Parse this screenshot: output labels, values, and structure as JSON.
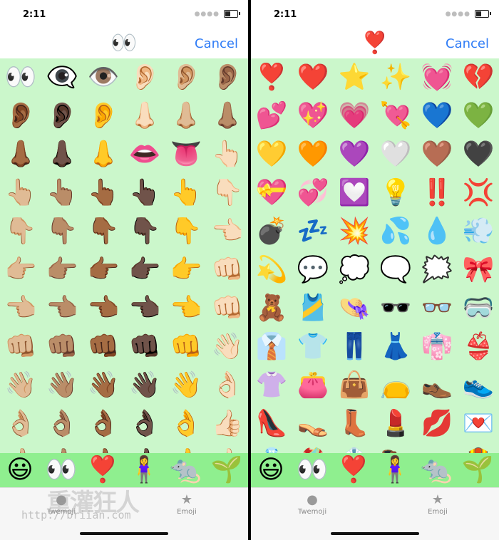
{
  "status_bar": {
    "time": "2:11"
  },
  "left_screen": {
    "nav_emoji": "👀",
    "cancel_label": "Cancel",
    "grid": [
      "👀",
      "👁️‍🗨️",
      "👁️",
      "👂🏻",
      "👂🏼",
      "👂🏽",
      "👂🏾",
      "👂🏿",
      "👂",
      "👃🏻",
      "👃🏼",
      "👃🏽",
      "👃🏾",
      "👃🏿",
      "👃",
      "👄",
      "👅",
      "👆🏻",
      "👆🏼",
      "👆🏽",
      "👆🏾",
      "👆🏿",
      "👆",
      "👇🏻",
      "👇🏼",
      "👇🏽",
      "👇🏾",
      "👇🏿",
      "👇",
      "👈🏻",
      "👉🏼",
      "👉🏽",
      "👉🏾",
      "👉🏿",
      "👉",
      "👊🏻",
      "👈🏼",
      "👈🏽",
      "👈🏾",
      "👈🏿",
      "👈",
      "👊🏻",
      "👊🏼",
      "👊🏽",
      "👊🏾",
      "👊🏿",
      "👊",
      "👋🏻",
      "👋🏼",
      "👋🏽",
      "👋🏾",
      "👋🏿",
      "👋",
      "👌🏻",
      "👌🏼",
      "👌🏽",
      "👌🏾",
      "👌🏿",
      "👌",
      "👍🏻",
      "👍🏼",
      "👍🏽",
      "👍🏾",
      "👍🏿",
      "👍",
      "👍🏻"
    ]
  },
  "right_screen": {
    "nav_emoji": "❣️",
    "cancel_label": "Cancel",
    "grid": [
      "❣️",
      "❤️",
      "⭐",
      "✨",
      "💓",
      "💔",
      "💕",
      "💖",
      "💗",
      "💘",
      "💙",
      "💚",
      "💛",
      "🧡",
      "💜",
      "🤍",
      "🤎",
      "🖤",
      "💝",
      "💞",
      "💟",
      "💡",
      "‼️",
      "💢",
      "💣",
      "💤",
      "💥",
      "💦",
      "💧",
      "💨",
      "💫",
      "💬",
      "💭",
      "🗨️",
      "🗯️",
      "🎀",
      "🧸",
      "🎽",
      "👒",
      "🕶️",
      "👓",
      "🥽",
      "👔",
      "👕",
      "👖",
      "👗",
      "👘",
      "👙",
      "👚",
      "👛",
      "👜",
      "👝",
      "👞",
      "👟",
      "👠",
      "👡",
      "👢",
      "💄",
      "💋",
      "💌",
      "💍",
      "🥻",
      "🥼",
      "🥾",
      "🥿",
      "🦺"
    ]
  },
  "category_bar": [
    "😃",
    "👀",
    "❣️",
    "🧍‍♀️",
    "🐀",
    "🌱",
    "☀️",
    "🎁"
  ],
  "tabs": [
    {
      "label": "Twemoji",
      "icon": "●"
    },
    {
      "label": "Emoji",
      "icon": "★"
    }
  ],
  "watermark": {
    "title": "重灌狂人",
    "url": "http://briian.com"
  }
}
